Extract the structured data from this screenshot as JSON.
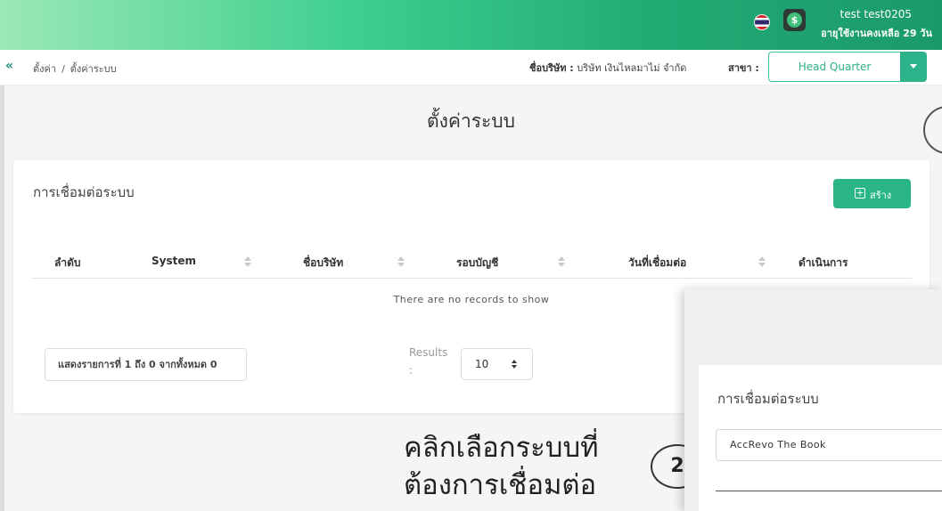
{
  "topbar": {
    "flag_icon": "thailand-flag-icon",
    "coin_icon": "dollar-coin-icon",
    "coin_symbol": "$",
    "user_name": "test test0205",
    "usage_remaining": "อายุใช้งานคงเหลือ 29 วัน",
    "gradient_colors": [
      "#9be8b6",
      "#3ccf8e",
      "#1a9a6a"
    ]
  },
  "breadcrumb_bar": {
    "collapse_icon": "«",
    "crumbs": [
      "ตั้งค่า",
      "ตั้งค่าระบบ"
    ],
    "separator": "/",
    "company_label": "ชื่อบริษัท :",
    "company_value": "บริษัท เงินไหลมาไม่ จำกัด",
    "branch_label": "สาขา :",
    "branch_value": "Head Quarter",
    "accent_color": "#2cb389"
  },
  "page": {
    "title": "ตั้งค่าระบบ"
  },
  "card": {
    "title": "การเชื่อมต่อระบบ",
    "create_button": "สร้าง",
    "create_icon": "+",
    "columns": [
      "ลำดับ",
      "System",
      "ชื่อบริษัท",
      "รอบบัญชี",
      "วันที่เชื่อมต่อ",
      "ดำเนินการ"
    ],
    "empty_message": "There are no records to show",
    "summary": "แสดงรายการที่ 1 ถึง 0 จากทั้งหมด 0",
    "results_label_line1": "Results",
    "results_label_line2": ":",
    "results_value": "10"
  },
  "annotation": {
    "instruction_line1": "คลิกเลือกระบบที่",
    "instruction_line2": "ต้องการเชื่อมต่อ",
    "step_number": "2"
  },
  "overlay": {
    "title": "การเชื่อมต่อระบบ",
    "system_value": "AccRevo The Book"
  }
}
